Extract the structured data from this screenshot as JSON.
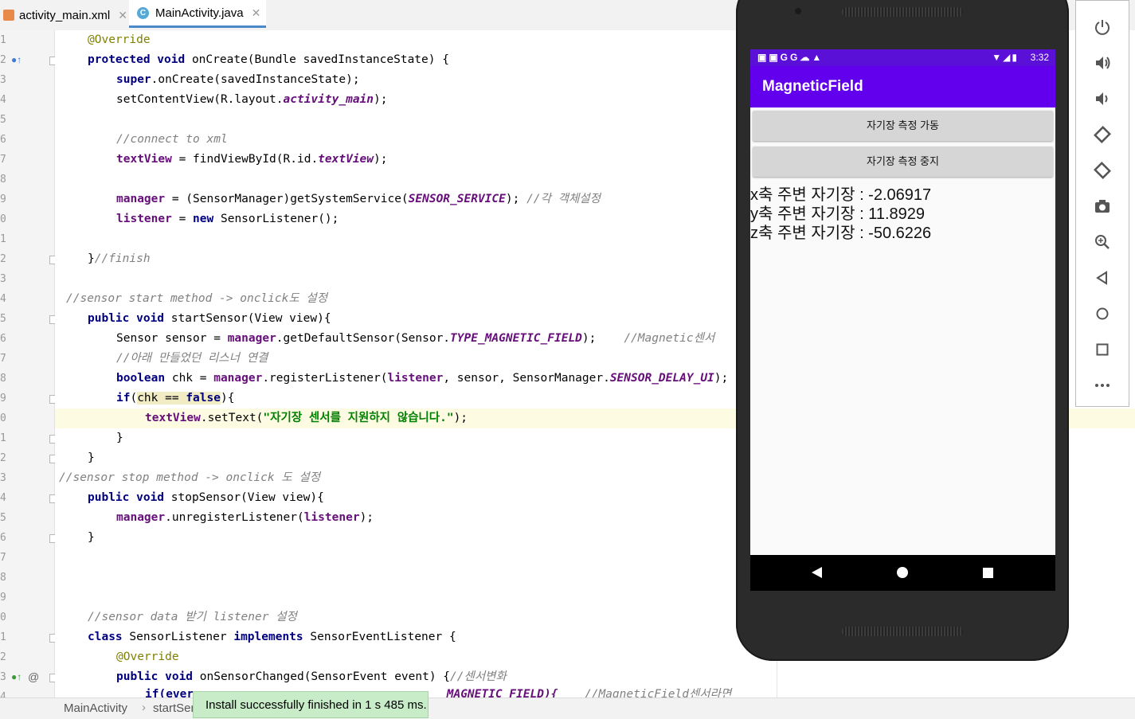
{
  "tabs": [
    {
      "label": "activity_main.xml",
      "active": false
    },
    {
      "label": "MainActivity.java",
      "active": true
    }
  ],
  "editor": {
    "line_numbers": [
      "1",
      "2",
      "3",
      "4",
      "5",
      "6",
      "7",
      "8",
      "9",
      "0",
      "1",
      "2",
      "3",
      "4",
      "5",
      "6",
      "7",
      "8",
      "9",
      "0",
      "1",
      "2",
      "3",
      "4",
      "5",
      "6",
      "7",
      "8",
      "9",
      "0",
      "1",
      "2",
      "3",
      "4"
    ]
  },
  "code": {
    "l1": "@Override",
    "l2_kw": "protected void",
    "l2_rest": " onCreate(Bundle savedInstanceState) {",
    "l3_kw": "super",
    "l3_rest": ".onCreate(savedInstanceState);",
    "l4_a": "setContentView(R.layout.",
    "l4_b": "activity_main",
    "l4_c": ");",
    "l6": "//connect to xml",
    "l7_a": "textView",
    "l7_b": " = findViewById(R.id.",
    "l7_c": "textView",
    "l7_d": ");",
    "l9_a": "manager",
    "l9_b": " = (SensorManager)getSystemService(",
    "l9_c": "SENSOR_SERVICE",
    "l9_d": "); ",
    "l9_e": "//각 객체설정",
    "l10_a": "listener",
    "l10_b": " = ",
    "l10_c": "new",
    "l10_d": " SensorListener();",
    "l12_a": "}",
    "l12_b": "//finish",
    "l14": "//sensor start method -> onclick도 설정",
    "l15_kw": "public void",
    "l15_rest": " startSensor(View view){",
    "l16_a": "Sensor sensor = ",
    "l16_b": "manager",
    "l16_c": ".getDefaultSensor(Sensor.",
    "l16_d": "TYPE_MAGNETIC_FIELD",
    "l16_e": ");    ",
    "l16_f": "//Magnetic센서",
    "l17": "//아래 만들었던 리스너 연결",
    "l18_a": "boolean",
    "l18_b": " chk = ",
    "l18_c": "manager",
    "l18_d": ".registerListener(",
    "l18_e": "listener",
    "l18_f": ", sensor, SensorManager.",
    "l18_g": "SENSOR_DELAY_UI",
    "l18_h": ");",
    "l19_a": "if",
    "l19_b": "(",
    "l19_c": "chk == ",
    "l19_d": "false",
    "l19_e": "){",
    "l20_a": "textView",
    "l20_b": ".setText(",
    "l20_c": "\"자기장 센서를 지원하지 않습니다.\"",
    "l20_d": ");",
    "l21": "}",
    "l22": "}",
    "l23": "//sensor stop method -> onclick 도 설정",
    "l24_kw": "public void",
    "l24_rest": " stopSensor(View view){",
    "l25_a": "manager",
    "l25_b": ".unregisterListener(",
    "l25_c": "listener",
    "l25_d": ");",
    "l26": "}",
    "l30": "//sensor data 받기 listener 설정",
    "l31_a": "class",
    "l31_b": " SensorListener ",
    "l31_c": "implements",
    "l31_d": " SensorEventListener {",
    "l32": "@Override",
    "l33_kw": "public void",
    "l33_rest": " onSensorChanged(SensorEvent event) {",
    "l33_cm": "//센서변화",
    "l34_a": "if(ever",
    "l34_b": "_MAGNETIC_FIELD){",
    "l34_c": "//MagneticField센서라면"
  },
  "status": {
    "crumb1": "MainActivity",
    "crumb2": "startSer",
    "toast": "Install successfully finished in 1 s 485 ms."
  },
  "phone": {
    "status_icons": "▣▣GG☁▲",
    "status_right_icons": "▼◢▮",
    "time": "3:32",
    "app_title": "MagneticField",
    "btn_start": "자기장 측정 가동",
    "btn_stop": "자기장 측정 중지",
    "x_reading": "x축 주변 자기장 : -2.06917",
    "y_reading": "y축 주변 자기장 : 11.8929",
    "z_reading": "z축 주변 자기장 : -50.6226"
  },
  "emulator_toolbar": [
    "power-icon",
    "volume-up-icon",
    "volume-down-icon",
    "rotate-left-icon",
    "rotate-right-icon",
    "camera-icon",
    "zoom-icon",
    "back-icon",
    "home-icon",
    "overview-icon",
    "more-icon"
  ]
}
